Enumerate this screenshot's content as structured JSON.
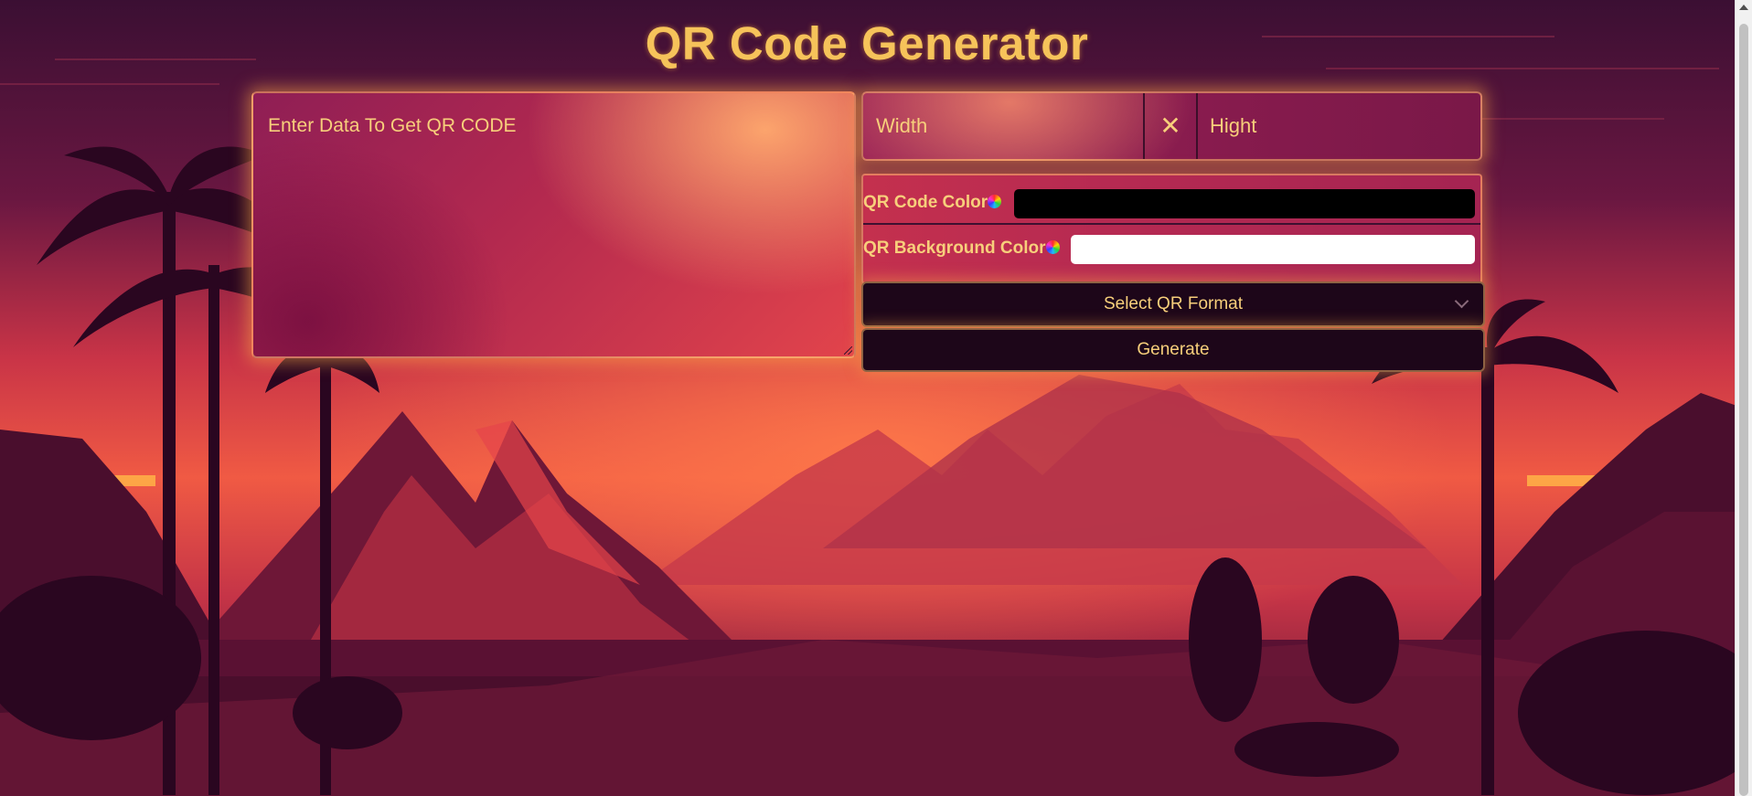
{
  "page": {
    "title": "QR Code Generator"
  },
  "form": {
    "data_placeholder": "Enter Data To Get QR CODE",
    "data_value": "",
    "width_placeholder": "Width",
    "width_value": "",
    "height_placeholder": "Hight",
    "height_value": "",
    "separator_icon": "times-icon",
    "qr_color_label": "QR Code Color",
    "qr_color_value": "#000000",
    "qr_bg_color_label": "QR Background Color",
    "qr_bg_color_value": "#ffffff",
    "color_icon": "color-wheel-icon",
    "format_select_label": "Select QR Format",
    "generate_label": "Generate"
  },
  "theme": {
    "accent": "#f6c35a",
    "button_bg": "#1d0619"
  }
}
